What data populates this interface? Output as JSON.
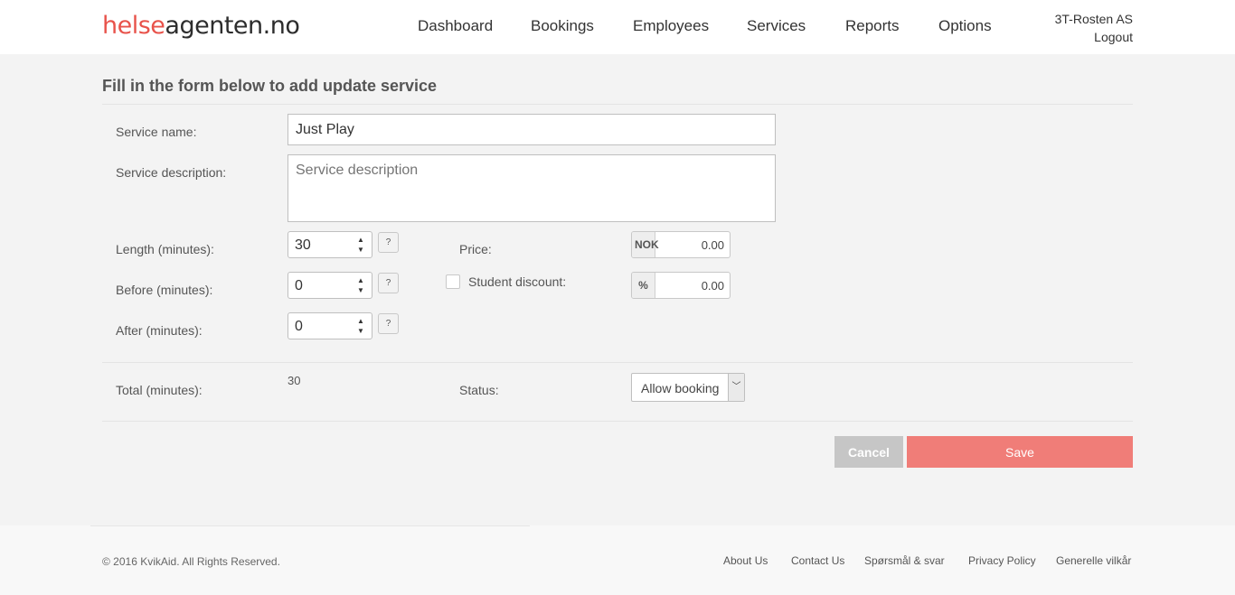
{
  "header": {
    "logo_part1": "helse",
    "logo_part2": "agenten.no",
    "nav": [
      "Dashboard",
      "Bookings",
      "Employees",
      "Services",
      "Reports",
      "Options"
    ],
    "company": "3T-Rosten AS",
    "logout": "Logout"
  },
  "form": {
    "title": "Fill in the form below to add update service",
    "service_name_label": "Service name:",
    "service_name_value": "Just Play",
    "service_description_label": "Service description:",
    "service_description_placeholder": "Service description",
    "length_label": "Length (minutes):",
    "length_value": "30",
    "before_label": "Before (minutes):",
    "before_value": "0",
    "after_label": "After (minutes):",
    "after_value": "0",
    "help_glyph": "?",
    "price_label": "Price:",
    "price_currency": "NOK",
    "price_value": "0.00",
    "student_discount_label": "Student discount:",
    "discount_unit": "%",
    "discount_value": "0.00",
    "total_label": "Total (minutes):",
    "total_value": "30",
    "status_label": "Status:",
    "status_value": "Allow booking",
    "cancel_label": "Cancel",
    "save_label": "Save"
  },
  "footer": {
    "copyright": "© 2016 KvikAid. All Rights Reserved.",
    "links": [
      "About Us",
      "Contact Us",
      "Spørsmål & svar",
      "Privacy Policy",
      "Generelle vilkår"
    ]
  },
  "colors": {
    "brand_red": "#e8534b",
    "save_button": "#f07d78",
    "cancel_button": "#c6c6c6"
  },
  "icons": {
    "spinner": "spinner-arrows-icon",
    "select": "chevron-down-icon",
    "help": "help-icon"
  }
}
